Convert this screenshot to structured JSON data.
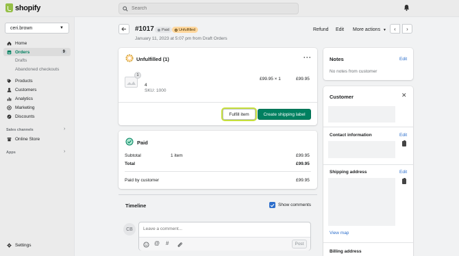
{
  "topbar": {
    "brand": "shopify",
    "search_placeholder": "Search"
  },
  "sidebar": {
    "store_name": "ceri.brown",
    "items": [
      {
        "label": "Home",
        "icon": "home-icon"
      },
      {
        "label": "Orders",
        "icon": "orders-icon",
        "badge": "9"
      },
      {
        "label": "Products",
        "icon": "tag-icon"
      },
      {
        "label": "Customers",
        "icon": "person-icon"
      },
      {
        "label": "Analytics",
        "icon": "bar-chart-icon"
      },
      {
        "label": "Marketing",
        "icon": "target-icon"
      },
      {
        "label": "Discounts",
        "icon": "discount-icon"
      }
    ],
    "orders_sub": [
      "Drafts",
      "Abandoned checkouts"
    ],
    "sales_channels_label": "Sales channels",
    "online_store": "Online Store",
    "apps_label": "Apps",
    "settings": "Settings"
  },
  "order": {
    "number": "#1017",
    "paid_badge": "Paid",
    "unfulfilled_badge": "Unfulfilled",
    "date": "January 11, 2023 at 5:07 pm from Draft Orders",
    "actions": {
      "refund": "Refund",
      "edit": "Edit",
      "more": "More actions"
    }
  },
  "unfulfilled": {
    "title": "Unfulfilled (1)",
    "qty_badge": "1",
    "item_name": "4",
    "sku": "SKU: 1000",
    "unit_price": "£99.95 × 1",
    "line_total": "£99.95",
    "fulfill_btn": "Fulfill item",
    "shipping_btn": "Create shipping label"
  },
  "paid": {
    "title": "Paid",
    "subtotal_label": "Subtotal",
    "subtotal_items": "1 item",
    "subtotal_value": "£99.95",
    "total_label": "Total",
    "total_value": "£99.95",
    "paid_by_label": "Paid by customer",
    "paid_by_value": "£99.95"
  },
  "timeline": {
    "title": "Timeline",
    "show_comments": "Show comments",
    "avatar": "CB",
    "comment_placeholder": "Leave a comment...",
    "post": "Post"
  },
  "notes": {
    "title": "Notes",
    "edit": "Edit",
    "empty": "No notes from customer"
  },
  "customer": {
    "title": "Customer",
    "contact_title": "Contact information",
    "contact_edit": "Edit",
    "shipping_title": "Shipping address",
    "shipping_edit": "Edit",
    "view_map": "View map",
    "billing_title": "Billing address"
  },
  "colors": {
    "accent": "#008060",
    "link": "#2c6ecb",
    "focus": "#c7e03b",
    "unfulfilled_bg": "#ffd79d"
  }
}
